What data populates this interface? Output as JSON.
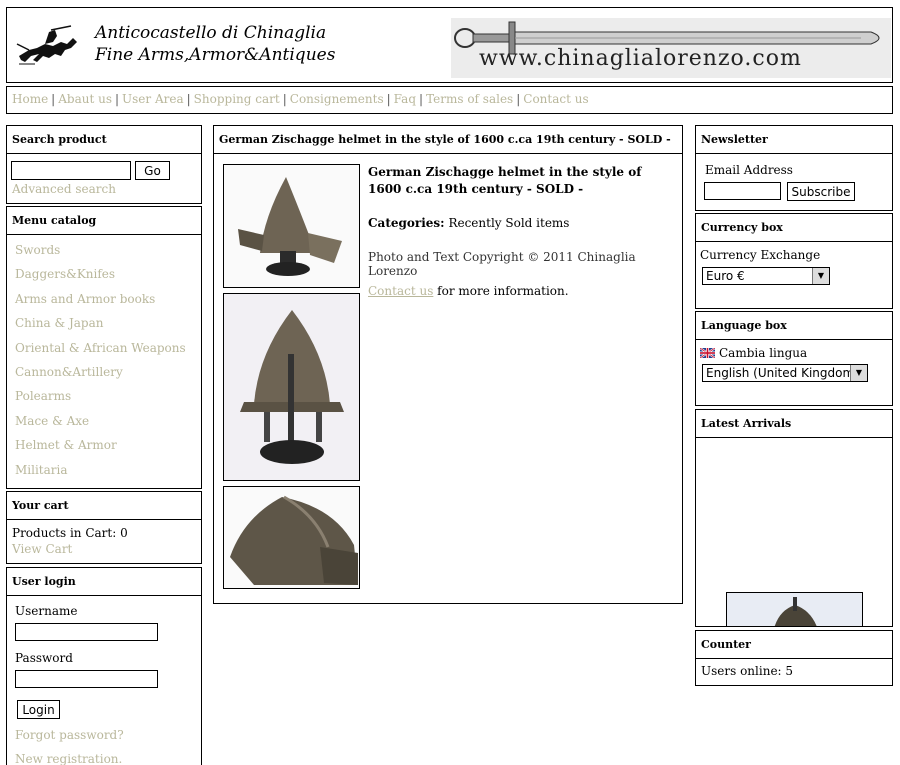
{
  "header": {
    "logo_line1": "Anticocastello di Chinaglia",
    "logo_line2": "Fine Arms,Armor&Antiques",
    "logo_url_text": "www.chinaglialorenzo.com"
  },
  "nav": {
    "items": [
      "Home",
      "Abaut us",
      "User Area",
      "Shopping cart",
      "Consignements",
      "Faq",
      "Terms of sales",
      "Contact us"
    ],
    "separator": "|"
  },
  "search": {
    "title": "Search product",
    "go_label": "Go",
    "advanced_label": "Advanced search"
  },
  "menu": {
    "title": "Menu catalog",
    "items": [
      "Swords",
      "Daggers&Knifes",
      "Arms and Armor books",
      "China & Japan",
      "Oriental & African Weapons",
      "Cannon&Artillery",
      "Polearms",
      "Mace & Axe",
      "Helmet & Armor",
      "Militaria"
    ]
  },
  "cart": {
    "title": "Your cart",
    "products_label": "Products in Cart: 0",
    "view_label": "View Cart"
  },
  "login": {
    "title": "User login",
    "username_label": "Username",
    "password_label": "Password",
    "button_label": "Login",
    "forgot_label": "Forgot password?",
    "register_label": "New registration."
  },
  "product": {
    "box_title": "German Zischagge helmet in the style of 1600 c.ca 19th century - SOLD -",
    "title": "German Zischagge helmet in the style of 1600 c.ca 19th century - SOLD -",
    "categories_label": "Categories:",
    "categories_value": "Recently Sold items",
    "copyright": "Photo and Text Copyright © 2011 Chinaglia Lorenzo",
    "contact_link": "Contact us",
    "contact_suffix": " for more information."
  },
  "newsletter": {
    "title": "Newsletter",
    "email_label": "Email Address",
    "subscribe_label": "Subscribe"
  },
  "currency": {
    "title": "Currency box",
    "label": "Currency Exchange",
    "selected": "Euro €"
  },
  "language": {
    "title": "Language box",
    "label": "Cambia lingua",
    "selected": "English (United Kingdom)"
  },
  "arrivals": {
    "title": "Latest Arrivals"
  },
  "counter": {
    "title": "Counter",
    "users_online": "Users online: 5"
  },
  "colors": {
    "link": "#b9b79b",
    "border": "#000000"
  }
}
